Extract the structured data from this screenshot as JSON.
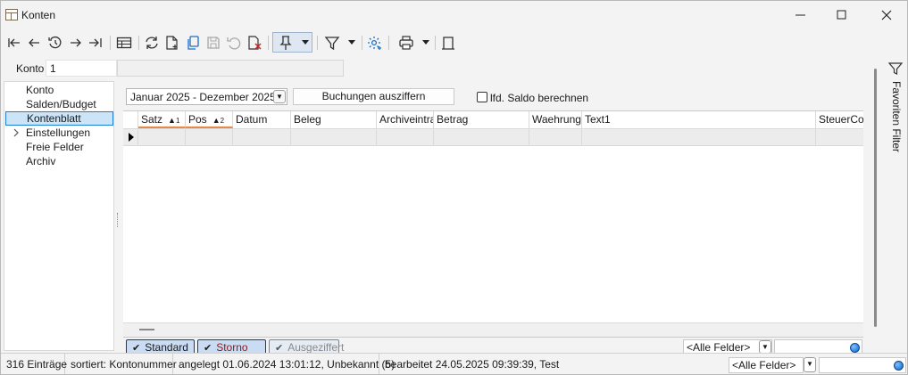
{
  "window": {
    "title": "Konten",
    "minimize": "—",
    "maximize": "☐",
    "close": "✕"
  },
  "toolbar": {
    "icons": [
      "first-icon",
      "back-icon",
      "history-icon",
      "forward-icon",
      "last-icon",
      "table-view-icon",
      "refresh-icon",
      "new-document-icon",
      "copy-icon",
      "save-icon",
      "undo-icon",
      "delete-icon",
      "pin-icon",
      "filter-icon",
      "settings-icon",
      "print-icon",
      "layout-icon"
    ]
  },
  "konto": {
    "label": "Konto",
    "value": "1"
  },
  "nav": {
    "items": [
      {
        "label": "Konto",
        "selected": false,
        "expandable": false
      },
      {
        "label": "Salden/Budget",
        "selected": false,
        "expandable": false
      },
      {
        "label": "Kontenblatt",
        "selected": true,
        "expandable": false
      },
      {
        "label": "Einstellungen",
        "selected": false,
        "expandable": true
      },
      {
        "label": "Freie Felder",
        "selected": false,
        "expandable": false
      },
      {
        "label": "Archiv",
        "selected": false,
        "expandable": false
      }
    ]
  },
  "main": {
    "period": "Januar 2025 - Dezember 2025",
    "ausziffern_button": "Buchungen ausziffern",
    "saldo_checkbox": {
      "label": "lfd. Saldo berechnen",
      "checked": false
    }
  },
  "grid": {
    "columns": [
      {
        "label": "Satz",
        "sort": "▲",
        "sort_order": "1"
      },
      {
        "label": "Pos",
        "sort": "▲",
        "sort_order": "2"
      },
      {
        "label": "Datum"
      },
      {
        "label": "Beleg"
      },
      {
        "label": "Archiveintrae"
      },
      {
        "label": "Betrag"
      },
      {
        "label": "Waehrung"
      },
      {
        "label": "Text1"
      },
      {
        "label": "SteuerCod"
      }
    ]
  },
  "tabs": [
    {
      "label": "Standard",
      "color": "#1a1a1a",
      "bg": "#c9dcf3"
    },
    {
      "label": "Storno",
      "color": "#8a1a1a",
      "bg": "#c9dcf3"
    },
    {
      "label": "Ausgeziffert",
      "color": "#8a8a8a",
      "bg": "#e6ecf4"
    }
  ],
  "grid_filter": {
    "field": "<Alle Felder>"
  },
  "right_panel": {
    "label": "Favoriten Filter"
  },
  "status": {
    "count": "316 Einträge",
    "sort": "sortiert: Kontonummer",
    "created": "angelegt 01.06.2024 13:01:12, Unbekannt (5)",
    "edited": "bearbeitet 24.05.2025 09:39:39, Test",
    "filter_field": "<Alle Felder>"
  }
}
